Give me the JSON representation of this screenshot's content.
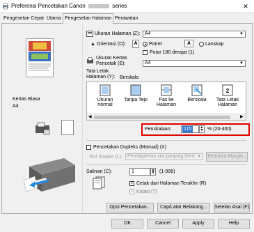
{
  "window": {
    "title": "Preferensi Pencetakan Canon",
    "title_suffix": "series",
    "close_glyph": "✕"
  },
  "tabs": [
    {
      "label": "Pengesetan Cepat",
      "active": false
    },
    {
      "label": "Utama",
      "active": false
    },
    {
      "label": "Pengesetan Halaman",
      "active": true
    },
    {
      "label": "Perawatan",
      "active": false
    }
  ],
  "preview": {
    "media_label": "Kertas Biasa",
    "size_label": "A4"
  },
  "page_size": {
    "label": "Ukuran Halaman (Z):",
    "value": "A4"
  },
  "orientation": {
    "label": "Orientasi (O):",
    "portrait_label": "Potret",
    "landscape_label": "Lanskap",
    "rotate_label": "Putar 180 derajat (1)",
    "selected": "portrait"
  },
  "paper_size": {
    "label_line1": "Ukuran Kertas",
    "label_line2": "Pencetak (E):",
    "value": "A4"
  },
  "layout": {
    "label_line1": "Tata Letak",
    "label_line2": "Halaman (Y):",
    "selected": "Berskala",
    "items": [
      {
        "label1": "Ukuran normal",
        "label2": ""
      },
      {
        "label1": "Tanpa Tepi",
        "label2": ""
      },
      {
        "label1": "Pas ke",
        "label2": "Halaman"
      },
      {
        "label1": "Berskala",
        "label2": ""
      },
      {
        "label1": "Tata Letak",
        "label2": "Halaman"
      }
    ]
  },
  "scaling": {
    "label": "Penskalaan:",
    "value": "115",
    "range": "% (20-400)"
  },
  "duplex": {
    "label": "Pencetakan Dupleks (Manual) (X)",
    "staple_label": "Sisi Stapler (L):",
    "staple_value": "Penstapleran sisi panjang (Kiri)",
    "margin_button": "Tentukan Margin..."
  },
  "copies": {
    "label": "Salinan (C):",
    "value": "1",
    "range": "(1-999)",
    "last_page_label": "Cetak dari Halaman Terakhir (R)",
    "collate_label": "Kolasi (T)"
  },
  "buttons": {
    "print_options": "Opsi Pencetakan...",
    "stamp": "Cap/Latar Belakang...",
    "defaults": "Setelan Asal (F)",
    "ok": "OK",
    "cancel": "Cancel",
    "apply": "Apply",
    "help": "Help"
  }
}
